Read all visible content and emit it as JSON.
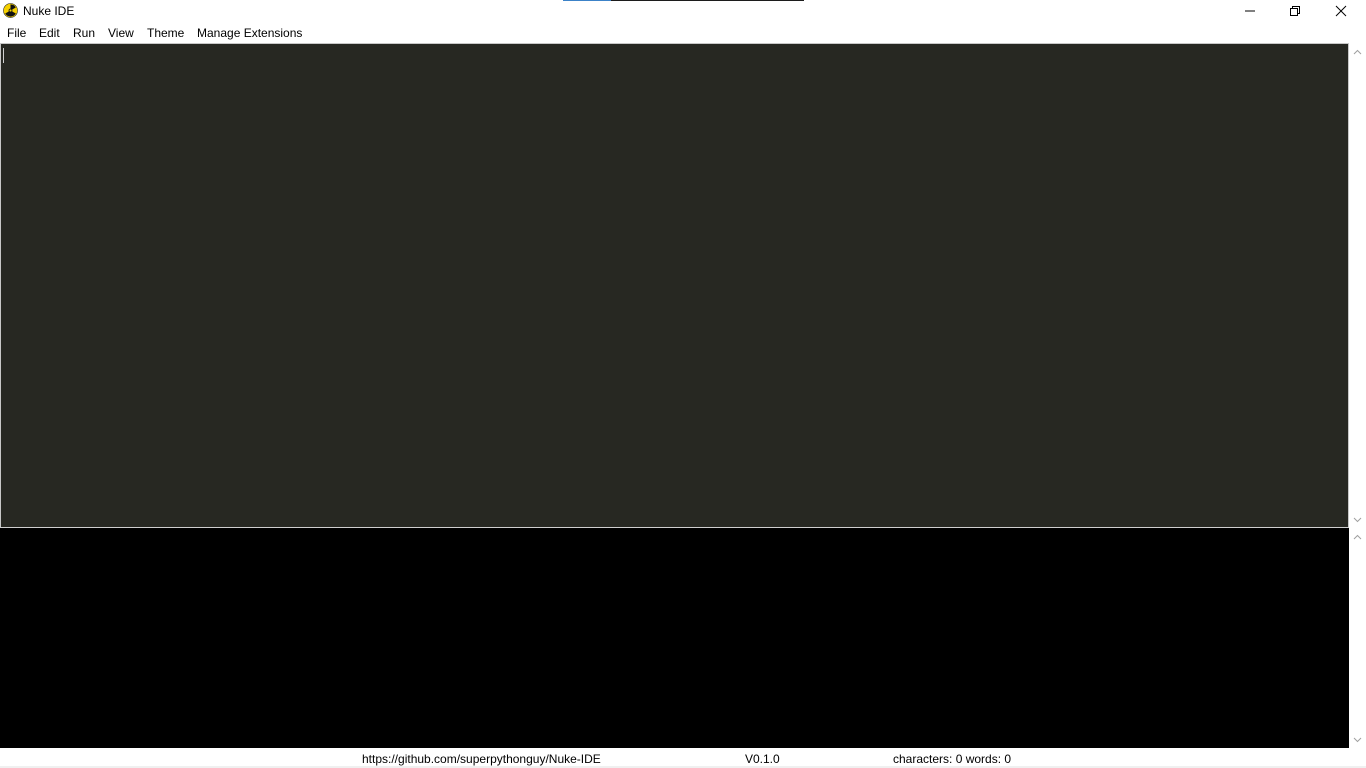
{
  "window": {
    "title": "Nuke IDE",
    "icon": "radiation-icon",
    "controls": [
      "minimize-icon",
      "restore-icon",
      "close-icon"
    ]
  },
  "menu": {
    "items": [
      {
        "label": "File"
      },
      {
        "label": "Edit"
      },
      {
        "label": "Run"
      },
      {
        "label": "View"
      },
      {
        "label": "Theme"
      },
      {
        "label": "Manage Extensions"
      }
    ]
  },
  "editor": {
    "content": "",
    "background": "#272822"
  },
  "output": {
    "content": "",
    "background": "#000000"
  },
  "status": {
    "repo": "https://github.com/superpythonguy/Nuke-IDE",
    "version": "V0.1.0",
    "counts": "characters: 0 words: 0"
  }
}
